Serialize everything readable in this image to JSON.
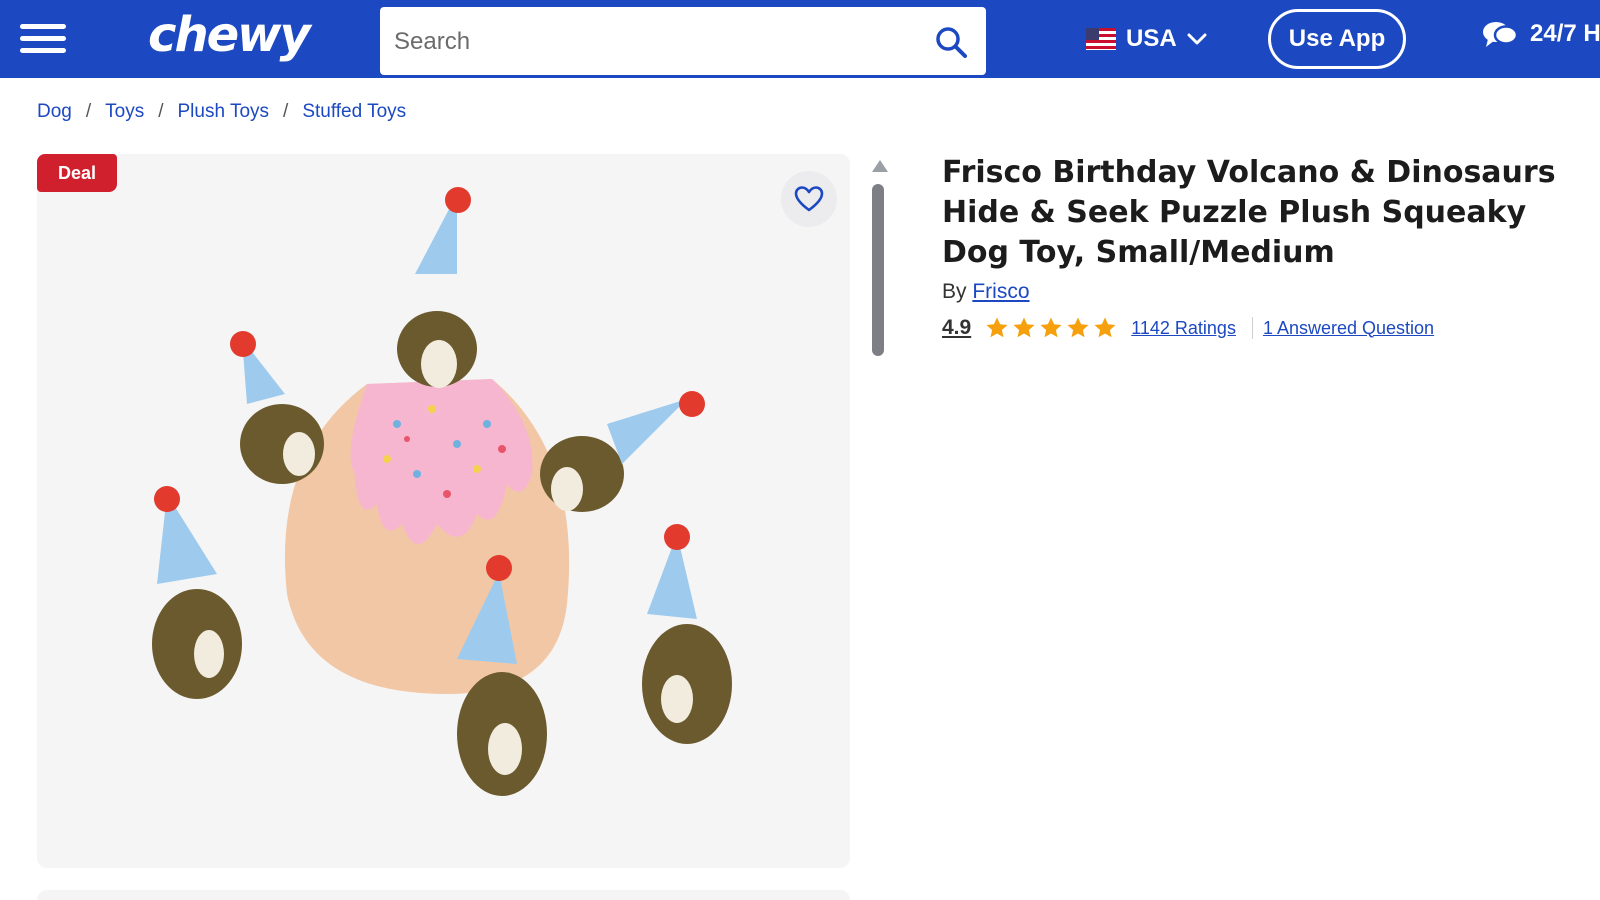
{
  "header": {
    "logo": "chewy",
    "search_placeholder": "Search",
    "country": "USA",
    "use_app": "Use App",
    "support": "24/7 H"
  },
  "breadcrumb": [
    "Dog",
    "Toys",
    "Plush Toys",
    "Stuffed Toys"
  ],
  "product": {
    "badge": "Deal",
    "title": "Frisco Birthday Volcano & Dinosaurs Hide & Seek Puzzle Plush Squeaky Dog Toy, Small/Medium",
    "by_label": "By",
    "brand": "Frisco",
    "rating": "4.9",
    "stars": 5,
    "ratings_link": "1142 Ratings",
    "question_link": "1 Answered Question"
  },
  "colors": {
    "brand_blue": "#1c49c2",
    "deal_red": "#d0202e",
    "star_orange": "#f5a00c"
  }
}
